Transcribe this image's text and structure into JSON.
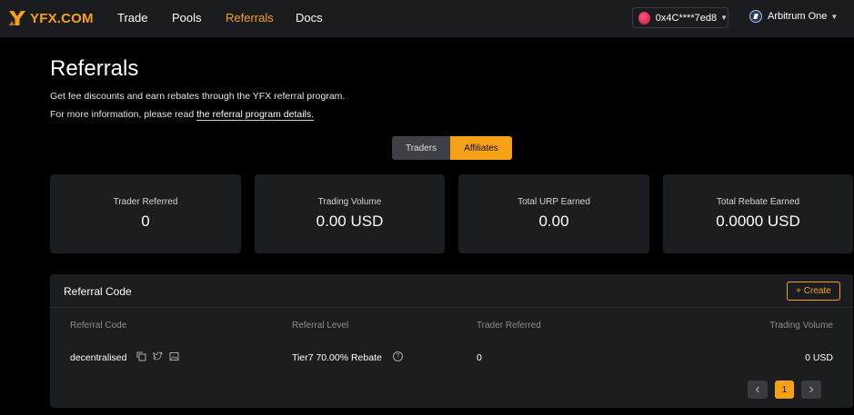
{
  "brand": {
    "name": "YFX.COM",
    "accent": "#f7a116"
  },
  "nav": {
    "links": [
      {
        "label": "Trade"
      },
      {
        "label": "Pools"
      },
      {
        "label": "Referrals",
        "active": true
      },
      {
        "label": "Docs"
      }
    ]
  },
  "wallet": {
    "address": "0x4C****7ed8"
  },
  "network": {
    "name": "Arbitrum One"
  },
  "page": {
    "title": "Referrals",
    "subtitle": "Get fee discounts and earn rebates through the YFX referral program.",
    "info_prefix": "For more information, please read ",
    "info_link": "the referral program details."
  },
  "toggle": {
    "traders": "Traders",
    "affiliates": "Affiliates",
    "selected": "Affiliates"
  },
  "stats": [
    {
      "label": "Trader Referred",
      "value": "0"
    },
    {
      "label": "Trading Volume",
      "value": "0.00 USD"
    },
    {
      "label": "Total URP Earned",
      "value": "0.00"
    },
    {
      "label": "Total Rebate Earned",
      "value": "0.0000 USD"
    }
  ],
  "referral_panel": {
    "title": "Referral Code",
    "create_label": "+ Create",
    "columns": [
      "Referral Code",
      "Referral Level",
      "Trader Referred",
      "Trading Volume"
    ],
    "rows": [
      {
        "code": "decentralised",
        "level": "Tier7 70.00% Rebate",
        "trader_referred": "0",
        "trading_volume": "0 USD"
      }
    ],
    "pagination": {
      "current": "1",
      "prev_icon": "chevron-left-icon",
      "next_icon": "chevron-right-icon"
    },
    "row_action_icons": [
      "copy-icon",
      "twitter-icon",
      "image-icon"
    ]
  }
}
